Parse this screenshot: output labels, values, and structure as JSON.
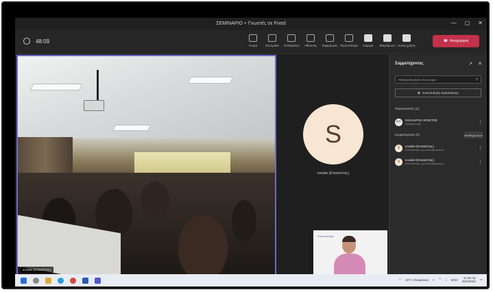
{
  "window": {
    "title": "ΣΕΜΙΝΑΡΙΟ + Γνωστές σε Fixed"
  },
  "toolbar": {
    "timer": "48:09",
    "tools": [
      "Άτομα",
      "Συνομιλία",
      "Αντιδράσεις",
      "Αίθουσες",
      "Εφαρμογές",
      "Περισσότερα",
      "Κάμερα",
      "Μικρόφωνο",
      "Κοινή χρήση"
    ],
    "leave_label": "Αποχώρηση"
  },
  "video": {
    "presenter_label": "sociale (Επισκέπτης)"
  },
  "middle": {
    "avatar_letter": "S",
    "avatar_name": "sociale (Επισκέπτης)",
    "self_logo": "Πανεπιστήμιο"
  },
  "panel": {
    "title": "Συμμετέχοντες",
    "search_placeholder": "Πληκτρολογήστε ένα όνομα",
    "share_button": "Κοινοποίηση πρόσκλησης",
    "presenters_header": "Παρουσιαστές (1)",
    "attendees_header": "Συμμετέχοντες (2)",
    "admit_all": "Αποδοχή όλων",
    "presenters": [
      {
        "initials": "ΚΧ",
        "name": "ΚΟΛΛΑΡΟΣ ΧΡΗΣΤΟΣ",
        "role": "Διοργανωτής"
      }
    ],
    "attendees": [
      {
        "initials": "S",
        "name": "sociale (Επισκέπτης)",
        "role": "Επισκέπτης, μη επαληθευμένος"
      },
      {
        "initials": "S",
        "name": "sociale (Επισκέπτης)",
        "role": "Επισκέπτης, μη επαληθευμένος"
      }
    ]
  },
  "taskbar": {
    "weather": "22°C Ηλιοφάνεια",
    "lang": "ENG",
    "time": "11:45 πμ",
    "date": "25/2/2023"
  },
  "colors": {
    "accent": "#6d6cc7",
    "leave": "#c4314b",
    "avatar_bg": "#f7e6d3"
  }
}
